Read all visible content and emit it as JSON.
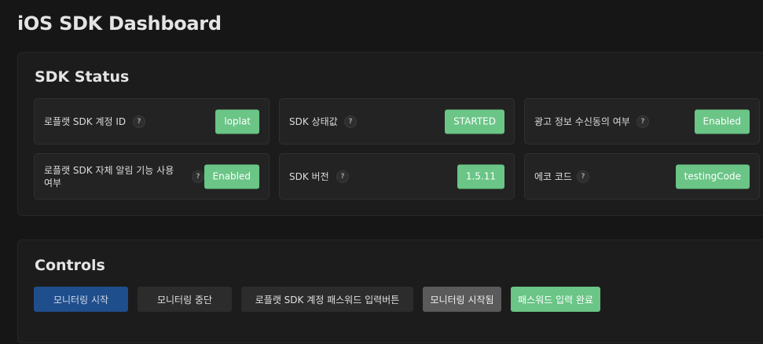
{
  "page": {
    "title": "iOS SDK Dashboard"
  },
  "status": {
    "title": "SDK Status",
    "help_symbol": "?",
    "cards": [
      {
        "label": "로플랫 SDK 계정 ID",
        "value": "loplat"
      },
      {
        "label": "SDK 상태값",
        "value": "STARTED"
      },
      {
        "label": "광고 정보 수신동의 여부",
        "value": "Enabled"
      },
      {
        "label": "로플랫 SDK 자체 알림 기능 사용 여부",
        "value": "Enabled"
      },
      {
        "label": "SDK 버전",
        "value": "1.5.11"
      },
      {
        "label": "에코 코드",
        "value": "testingCode"
      }
    ]
  },
  "controls": {
    "title": "Controls",
    "buttons": [
      {
        "label": "모니터링 시작"
      },
      {
        "label": "모니터링 중단"
      },
      {
        "label": "로플랫 SDK 계정 패스워드 입력버튼"
      },
      {
        "label": "모니터링 시작됨"
      },
      {
        "label": "패스워드 입력 완료"
      }
    ]
  },
  "colors": {
    "accent_green": "#6ac586",
    "primary_blue": "#1f4e8c",
    "background": "#161616"
  }
}
